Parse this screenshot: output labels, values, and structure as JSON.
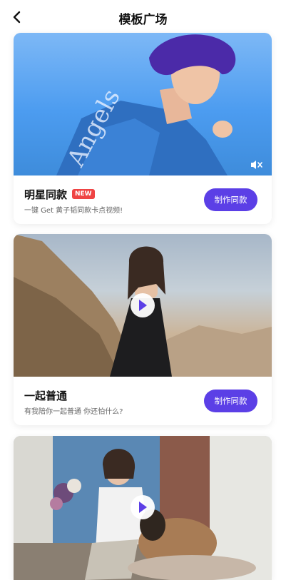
{
  "nav": {
    "title": "模板广场",
    "back_icon": "chevron-left-icon"
  },
  "cards": [
    {
      "name": "明星同款",
      "badge": "NEW",
      "desc": "一键 Get 黄子韬同款卡点视频!",
      "cta": "制作同款",
      "media_icon": "mute-icon"
    },
    {
      "name": "一起普通",
      "desc": "有我陪你一起普通 你还怕什么?",
      "cta": "制作同款",
      "media_icon": "play-icon"
    },
    {
      "media_icon": "play-icon"
    }
  ],
  "colors": {
    "accent": "#5b3fe6",
    "badge": "#ef4444"
  }
}
